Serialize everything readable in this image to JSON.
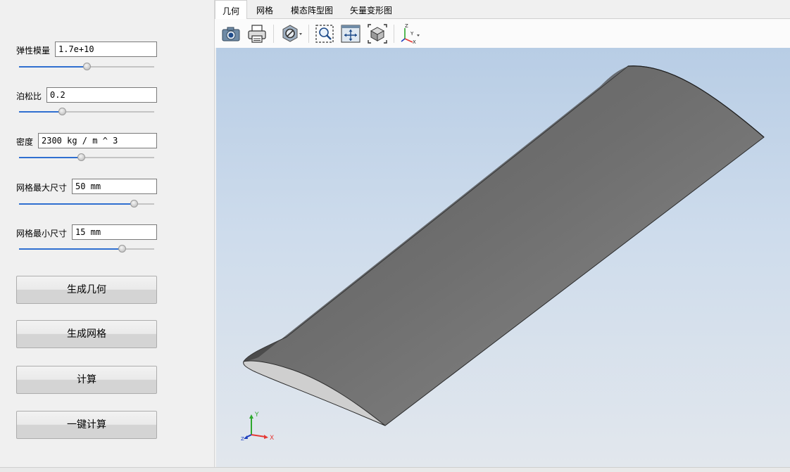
{
  "params": [
    {
      "label": "弹性模量",
      "value": "1.7e+10",
      "slider_value": 0.5
    },
    {
      "label": "泊松比",
      "value": "0.2",
      "slider_value": 0.32
    },
    {
      "label": "密度",
      "value": "2300 kg / m ^ 3",
      "slider_value": 0.46
    },
    {
      "label": "网格最大尺寸",
      "value": "50 mm",
      "slider_value": 0.85
    },
    {
      "label": "网格最小尺寸",
      "value": "15 mm",
      "slider_value": 0.76
    }
  ],
  "buttons": {
    "generate_geometry": "生成几何",
    "generate_mesh": "生成网格",
    "compute": "计算",
    "one_click_compute": "一键计算"
  },
  "tabs": [
    "几何",
    "网格",
    "模态阵型图",
    "矢量变形图"
  ],
  "active_tab": "几何",
  "toolbar_icons": [
    "camera-icon",
    "printer-icon",
    "display-mode-icon",
    "zoom-window-icon",
    "fit-all-icon",
    "view-cube-icon",
    "axes-orientation-icon"
  ],
  "view_axes_icon_labels": {
    "z": "Z",
    "y": "Y",
    "x": "X"
  },
  "triad": {
    "y": "Y",
    "x": "X",
    "z": "Z"
  },
  "colors": {
    "slider_fill": "#2f6fd0",
    "viewport_top": "#b8cde5",
    "viewport_bottom": "#e2e7ed",
    "triad_x": "#e53935",
    "triad_y": "#2ea82e",
    "triad_z": "#1e3fbf"
  }
}
